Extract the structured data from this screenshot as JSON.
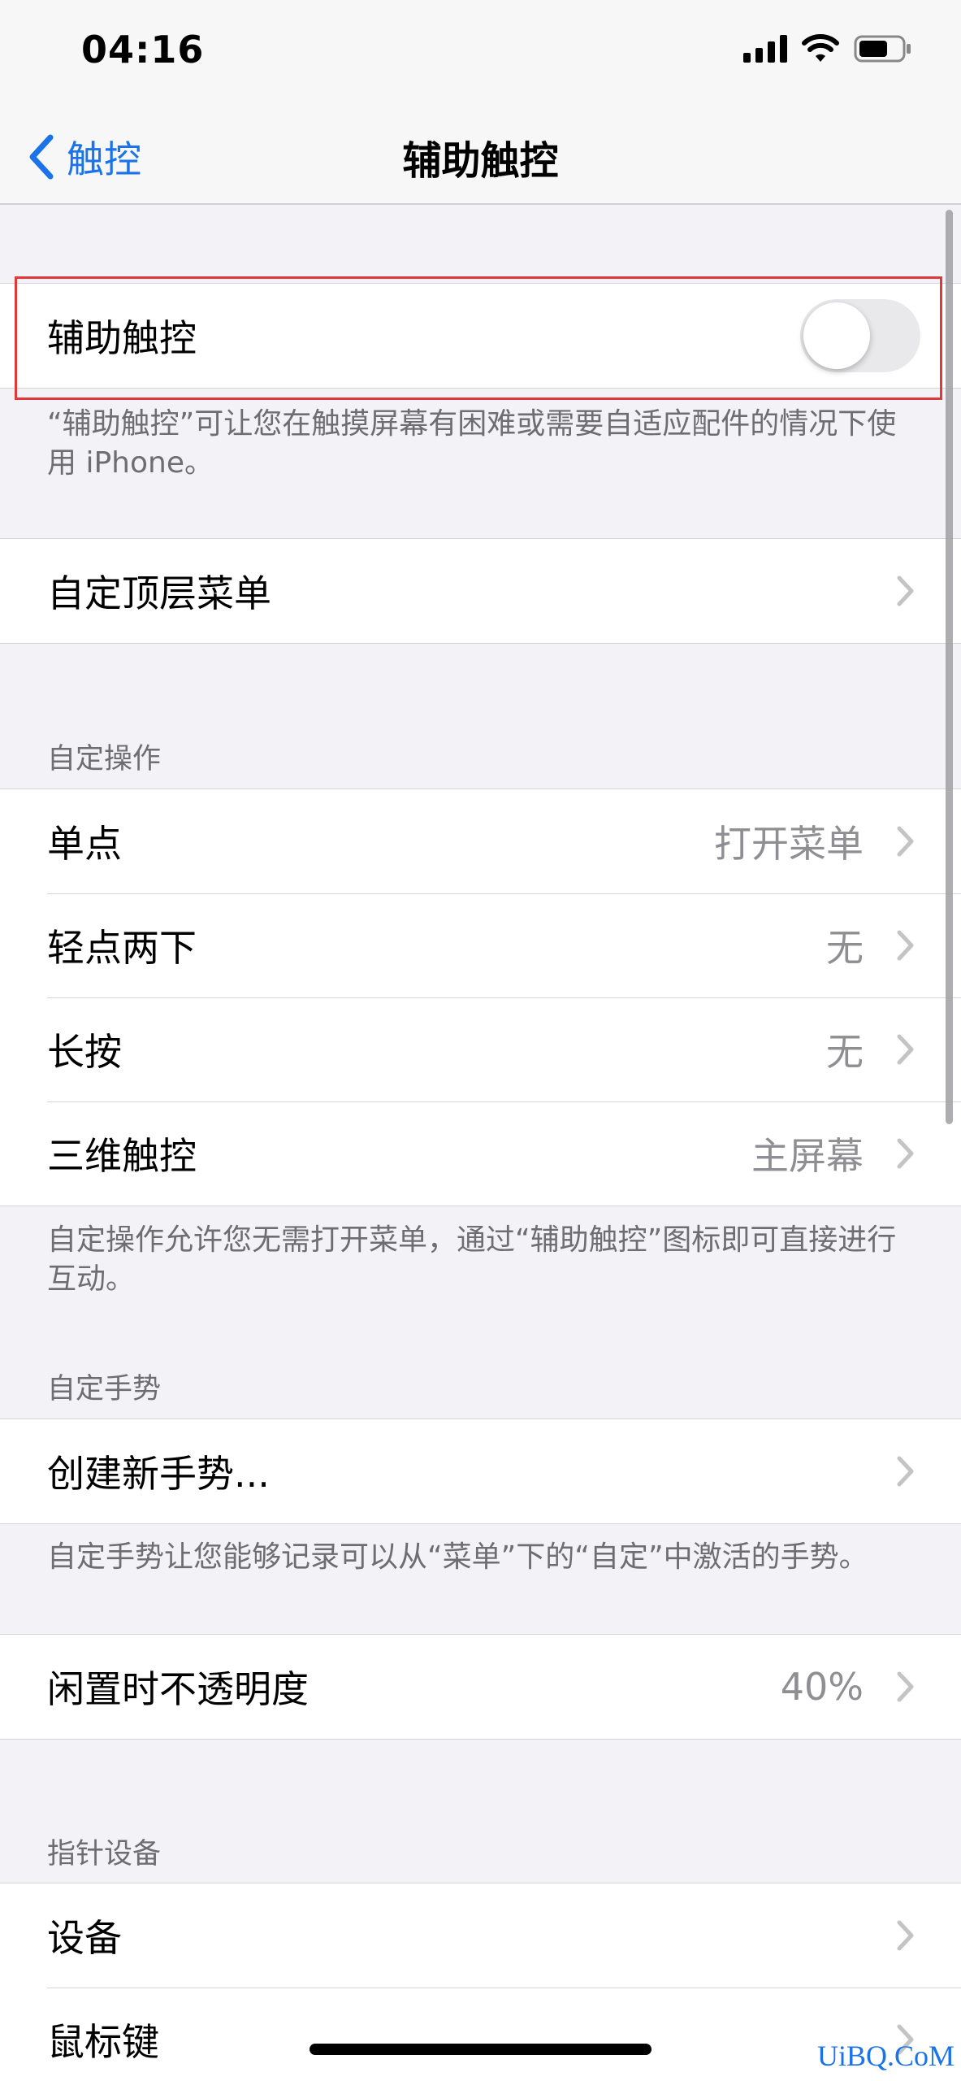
{
  "status_bar": {
    "time": "04:16",
    "icons": [
      "signal-icon",
      "wifi-icon",
      "battery-icon"
    ]
  },
  "nav": {
    "back_label": "触控",
    "title": "辅助触控"
  },
  "toggle_group": {
    "label": "辅助触控",
    "enabled": false,
    "footer": "“辅助触控”可让您在触摸屏幕有困难或需要自适应配件的情况下使用 iPhone。"
  },
  "top_menu": {
    "label": "自定顶层菜单"
  },
  "custom_actions": {
    "header": "自定操作",
    "rows": [
      {
        "label": "单点",
        "value": "打开菜单"
      },
      {
        "label": "轻点两下",
        "value": "无"
      },
      {
        "label": "长按",
        "value": "无"
      },
      {
        "label": "三维触控",
        "value": "主屏幕"
      }
    ],
    "footer": "自定操作允许您无需打开菜单，通过“辅助触控”图标即可直接进行互动。"
  },
  "custom_gestures": {
    "header": "自定手势",
    "create_label": "创建新手势...",
    "footer": "自定手势让您能够记录可以从“菜单”下的“自定”中激活的手势。"
  },
  "idle_opacity": {
    "label": "闲置时不透明度",
    "value": "40%"
  },
  "pointer_devices": {
    "header": "指针设备",
    "rows": [
      {
        "label": "设备"
      },
      {
        "label": "鼠标键"
      }
    ]
  },
  "watermark": "UiBQ.CoM",
  "colors": {
    "accent": "#1a73e8",
    "highlight": "#e0393a",
    "background": "#f2f2f7",
    "secondary_text": "#8e8e93"
  }
}
